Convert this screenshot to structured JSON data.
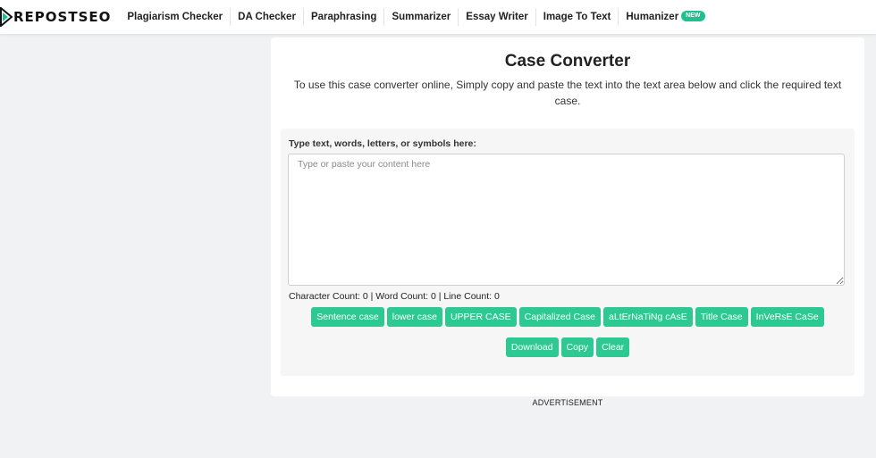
{
  "brand": {
    "name": "REPOSTSEO",
    "accent": "#1fbf8f"
  },
  "nav": {
    "items": [
      {
        "label": "Plagiarism Checker"
      },
      {
        "label": "DA Checker"
      },
      {
        "label": "Paraphrasing"
      },
      {
        "label": "Summarizer"
      },
      {
        "label": "Essay Writer"
      },
      {
        "label": "Image To Text"
      },
      {
        "label": "Humanizer",
        "badge": "NEW"
      }
    ]
  },
  "page": {
    "title": "Case Converter",
    "subtitle": "To use this case converter online, Simply copy and paste the text into the text area below and click the required text case."
  },
  "editor": {
    "label": "Type text, words, letters, or symbols here:",
    "value": "",
    "placeholder": "Type or paste your content here",
    "counts": "Character Count: 0 | Word Count: 0 | Line Count: 0"
  },
  "case_buttons": [
    "Sentence case",
    "lower case",
    "UPPER CASE",
    "Capitalized Case",
    "aLtErNaTiNg cAsE",
    "Title Case",
    "InVeRsE CaSe"
  ],
  "action_buttons": [
    "Download",
    "Copy",
    "Clear"
  ],
  "advertisement": {
    "label": "ADVERTISEMENT"
  },
  "colors": {
    "button": "#2ec993",
    "panel": "#f6f6f6",
    "background": "#f1f2f3"
  }
}
